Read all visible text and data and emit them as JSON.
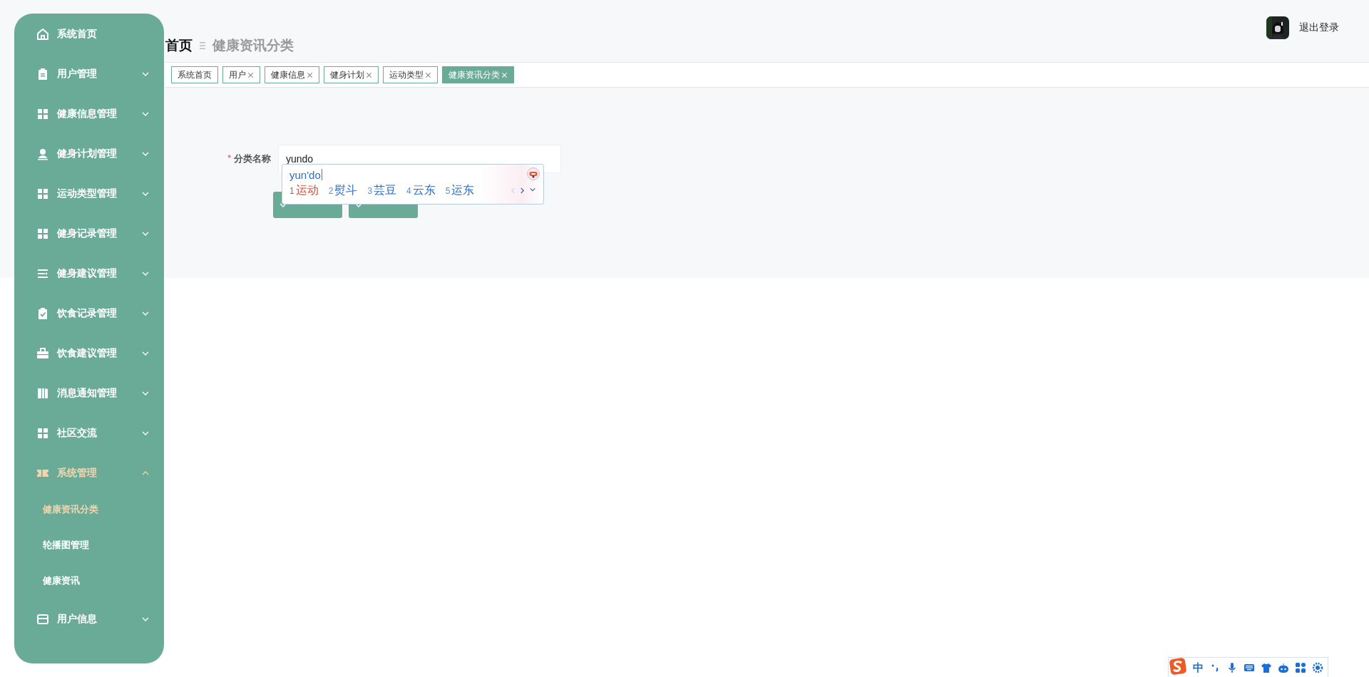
{
  "sidebar": {
    "items": [
      {
        "kind": "link",
        "label": "系统首页",
        "selected": false
      },
      {
        "kind": "group",
        "label": "用户管理",
        "expanded": false,
        "selected": false
      },
      {
        "kind": "group",
        "label": "健康信息管理",
        "expanded": false,
        "selected": false
      },
      {
        "kind": "group",
        "label": "健身计划管理",
        "expanded": false,
        "selected": false
      },
      {
        "kind": "group",
        "label": "运动类型管理",
        "expanded": false,
        "selected": false
      },
      {
        "kind": "group",
        "label": "健身记录管理",
        "expanded": false,
        "selected": false
      },
      {
        "kind": "group",
        "label": "健身建议管理",
        "expanded": false,
        "selected": false
      },
      {
        "kind": "group",
        "label": "饮食记录管理",
        "expanded": false,
        "selected": false
      },
      {
        "kind": "group",
        "label": "饮食建议管理",
        "expanded": false,
        "selected": false
      },
      {
        "kind": "group",
        "label": "消息通知管理",
        "expanded": false,
        "selected": false
      },
      {
        "kind": "group",
        "label": "社区交流",
        "expanded": false,
        "selected": false
      },
      {
        "kind": "group",
        "label": "系统管理",
        "expanded": true,
        "selected": true,
        "children": [
          {
            "label": "健康资讯分类",
            "selected": true
          },
          {
            "label": "轮播图管理",
            "selected": false
          },
          {
            "label": "健康资讯",
            "selected": false
          }
        ]
      },
      {
        "kind": "group",
        "label": "用户信息",
        "expanded": false,
        "selected": false
      }
    ]
  },
  "header": {
    "breadcrumb": [
      "首页",
      "健康资讯分类"
    ],
    "logout": "退出登录"
  },
  "tabs": [
    {
      "label": "系统首页",
      "closable": false,
      "selected": false
    },
    {
      "label": "用户",
      "closable": true,
      "selected": false
    },
    {
      "label": "健康信息",
      "closable": true,
      "selected": false
    },
    {
      "label": "健身计划",
      "closable": true,
      "selected": false
    },
    {
      "label": "运动类型",
      "closable": true,
      "selected": false
    },
    {
      "label": "健康资讯分类",
      "closable": true,
      "selected": true
    }
  ],
  "form": {
    "field": {
      "required_mark": "*",
      "label": "分类名称",
      "value": "yundo"
    }
  },
  "ime": {
    "composition": "yun'do",
    "candidates": [
      {
        "number": "1",
        "word": "运动",
        "selected": true
      },
      {
        "number": "2",
        "word": "熨斗",
        "selected": false
      },
      {
        "number": "3",
        "word": "芸豆",
        "selected": false
      },
      {
        "number": "4",
        "word": "云东",
        "selected": false
      },
      {
        "number": "5",
        "word": "运东",
        "selected": false
      }
    ]
  },
  "ime_toolbar": {
    "mode": "中"
  }
}
